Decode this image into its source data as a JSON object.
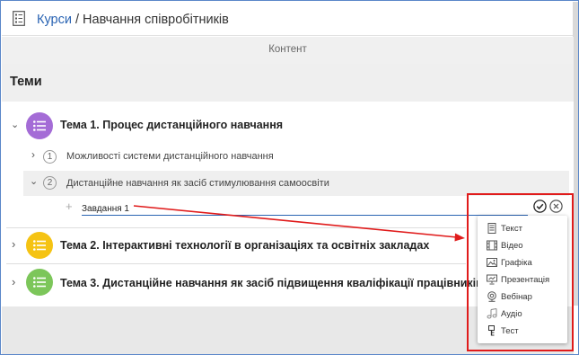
{
  "header": {
    "breadcrumb_link": "Курси",
    "breadcrumb_sep": " / ",
    "breadcrumb_current": "Навчання співробітників"
  },
  "content_label": "Контент",
  "topics_heading": "Теми",
  "topics": [
    {
      "title": "Тема 1. Процес дистанційного навчання",
      "color": "#a46cd6",
      "expanded": true,
      "subtopics": [
        {
          "number": "1",
          "title": "Можливості системи дистанційного навчання",
          "expanded": false
        },
        {
          "number": "2",
          "title": "Дистанційне навчання як засіб стимулювання самоосвіти",
          "expanded": true
        }
      ]
    },
    {
      "title": "Тема 2. Інтерактивні технології в організаціях та освітніх закладах",
      "color": "#f5c313",
      "expanded": false
    },
    {
      "title": "Тема 3. Дистанційне навчання як засіб підвищення кваліфікації працівників",
      "color": "#7cc65a",
      "expanded": false
    }
  ],
  "new_task": {
    "value": "Завдання 1"
  },
  "icons": {
    "header": "document-list-icon",
    "confirm": "check-circle-icon",
    "cancel": "x-circle-icon",
    "add": "plus-icon"
  },
  "type_menu": [
    {
      "label": "Текст",
      "icon": "text-document-icon"
    },
    {
      "label": "Відео",
      "icon": "film-icon"
    },
    {
      "label": "Графіка",
      "icon": "image-icon"
    },
    {
      "label": "Презентація",
      "icon": "presentation-icon"
    },
    {
      "label": "Вебінар",
      "icon": "webcam-icon"
    },
    {
      "label": "Аудіо",
      "icon": "music-note-icon"
    },
    {
      "label": "Тест",
      "icon": "test-icon"
    }
  ],
  "colors": {
    "link": "#2a64b3",
    "annotation": "#e01b1b"
  }
}
